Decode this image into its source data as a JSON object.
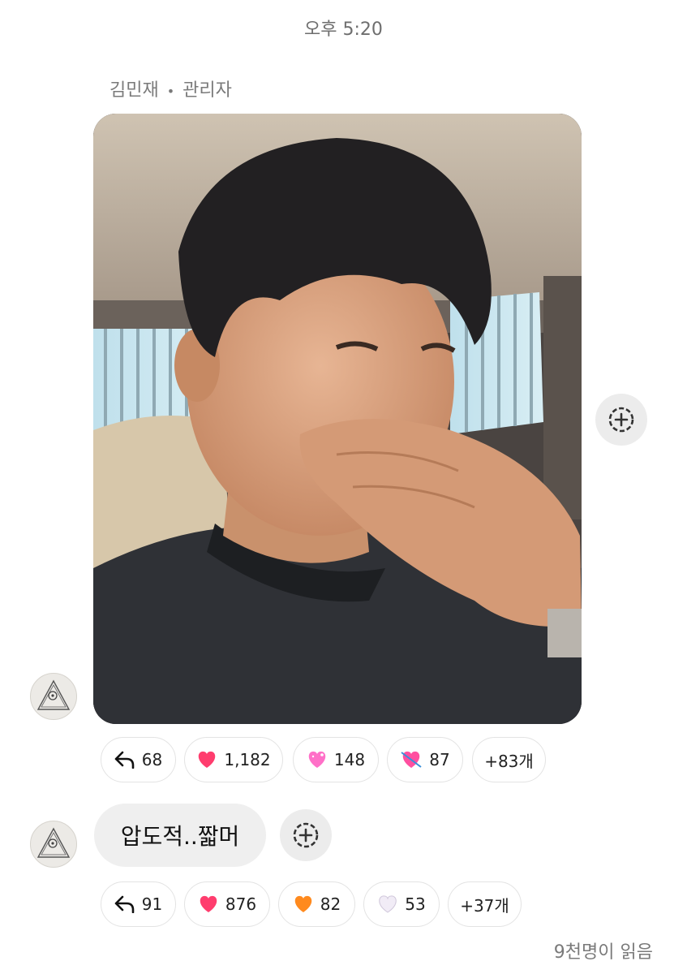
{
  "timestamp": "오후 5:20",
  "sender": {
    "name": "김민재",
    "role": "관리자"
  },
  "message1": {
    "reactions": {
      "reply_count": "68",
      "heart": "1,182",
      "sparkle_heart": "148",
      "arrow_heart": "87",
      "more": "+83개"
    }
  },
  "message2": {
    "text": "압도적..짧머",
    "reactions": {
      "reply_count": "91",
      "heart": "876",
      "orange_heart": "82",
      "white_heart": "53",
      "more": "+37개"
    }
  },
  "read_status": "9천명이 읽음",
  "colors": {
    "heart": "#ff3d6e",
    "orange_heart": "#ff8a1e",
    "white_heart": "#f1ecf6",
    "chip_border": "#e3e3e3",
    "bubble": "#efefef"
  }
}
